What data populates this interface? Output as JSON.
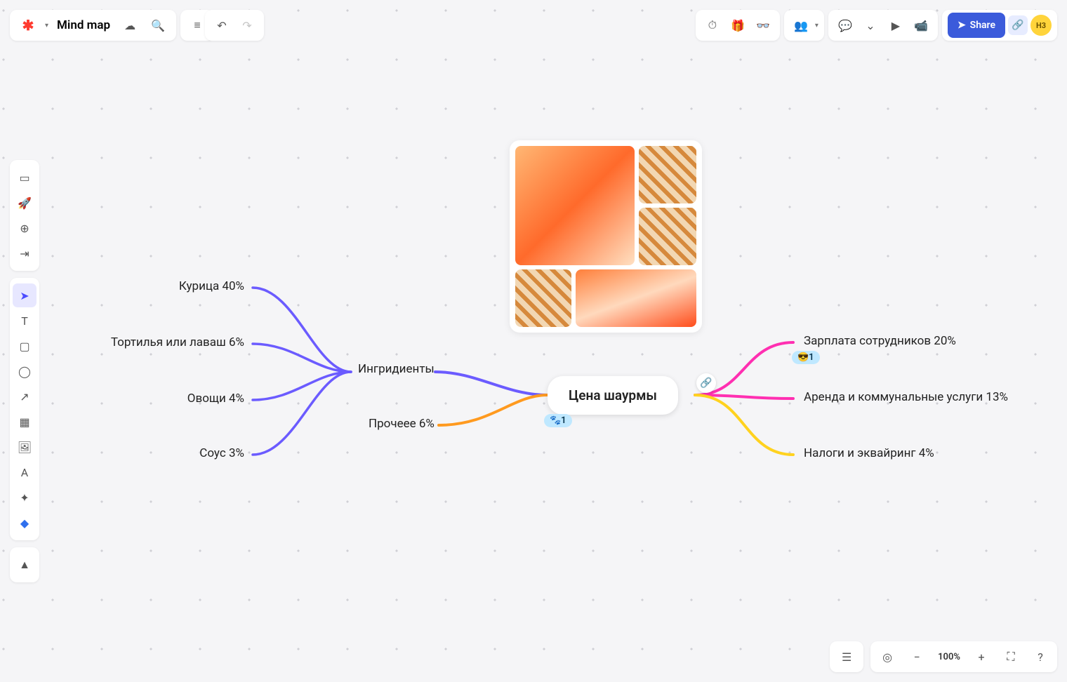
{
  "header": {
    "title": "Mind map",
    "share_label": "Share",
    "avatar_initials": "H3",
    "zoom_label": "100%"
  },
  "mindmap": {
    "center": "Цена шаурмы",
    "left_parent": "Ингридиенты",
    "left_branch2": "Прочеее 6%",
    "left_children": [
      "Курица 40%",
      "Тортилья или лаваш 6%",
      "Овощи 4%",
      "Соус 3%"
    ],
    "right_children": [
      "Зарплата сотрудников 20%",
      "Аренда и коммунальные услуги 13%",
      "Налоги и эквайринг 4%"
    ],
    "badge_left": "🐾1",
    "badge_right": "😎1"
  },
  "icons": {
    "cloud": "☁",
    "search": "🔍",
    "menu": "≡",
    "undo": "↶",
    "redo": "↷",
    "timer": "⏱",
    "gift": "🎁",
    "binoc": "👓",
    "people": "👥",
    "comment": "💬",
    "down": "⌄",
    "play": "▶",
    "cam": "📹",
    "send": "➤",
    "link": "🔗",
    "frame": "▭",
    "rocket": "🚀",
    "addframe": "⊕",
    "import": "⇥",
    "cursor": "➤",
    "text": "T",
    "note": "▢",
    "shape": "◯",
    "line": "↗",
    "table": "▦",
    "image": "🖼",
    "font": "A",
    "spark": "✦",
    "diamond": "◆",
    "shapes": "▲",
    "list": "☰",
    "target": "◎",
    "minus": "−",
    "plus": "+",
    "expand": "⛶",
    "help": "?"
  }
}
